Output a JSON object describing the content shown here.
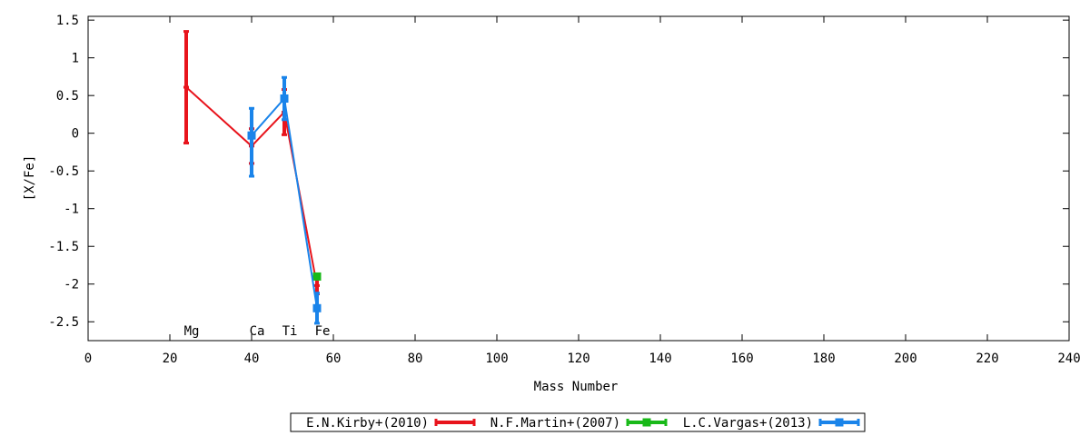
{
  "chart_data": {
    "type": "scatter",
    "xlabel": "Mass Number",
    "ylabel": "[X/Fe]",
    "xlim": [
      0,
      240
    ],
    "ylim": [
      -2.75,
      1.55
    ],
    "x_ticks": [
      0,
      20,
      40,
      60,
      80,
      100,
      120,
      140,
      160,
      180,
      200,
      220,
      240
    ],
    "y_ticks": [
      1.5,
      1,
      0.5,
      0,
      -0.5,
      -1,
      -1.5,
      -2,
      -2.5
    ],
    "y_tick_labels": [
      "1.5",
      "1",
      "0.5",
      "0",
      "-0.5",
      "-1",
      "-1.5",
      "-2",
      "-2.5"
    ],
    "grid": false,
    "legend_position": "bottom-center",
    "element_labels": [
      {
        "text": "Mg",
        "x": 24
      },
      {
        "text": "Ca",
        "x": 40
      },
      {
        "text": "Ti",
        "x": 48
      },
      {
        "text": "Fe",
        "x": 56
      }
    ],
    "series": [
      {
        "name": "E.N.Kirby+(2010)",
        "color": "#e8141c",
        "marker": "none",
        "points": [
          {
            "x": 24,
            "y": 0.61,
            "err_low": -0.13,
            "err_high": 1.35
          },
          {
            "x": 40,
            "y": -0.17,
            "err_low": -0.4,
            "err_high": 0.06
          },
          {
            "x": 48,
            "y": 0.28,
            "err_low": -0.02,
            "err_high": 0.58
          },
          {
            "x": 56,
            "y": -2.02,
            "err_low": -2.13,
            "err_high": -1.91
          }
        ]
      },
      {
        "name": "N.F.Martin+(2007)",
        "color": "#18b918",
        "marker": "square",
        "points": [
          {
            "x": 56,
            "y": -1.9,
            "err_low": -1.93,
            "err_high": -1.87
          }
        ]
      },
      {
        "name": "L.C.Vargas+(2013)",
        "color": "#1a84ea",
        "marker": "square",
        "points": [
          {
            "x": 40,
            "y": -0.03,
            "err_low": -0.57,
            "err_high": 0.33
          },
          {
            "x": 48,
            "y": 0.46,
            "err_low": 0.18,
            "err_high": 0.74
          },
          {
            "x": 56,
            "y": -2.32,
            "err_low": -2.52,
            "err_high": -2.12
          }
        ]
      }
    ]
  }
}
